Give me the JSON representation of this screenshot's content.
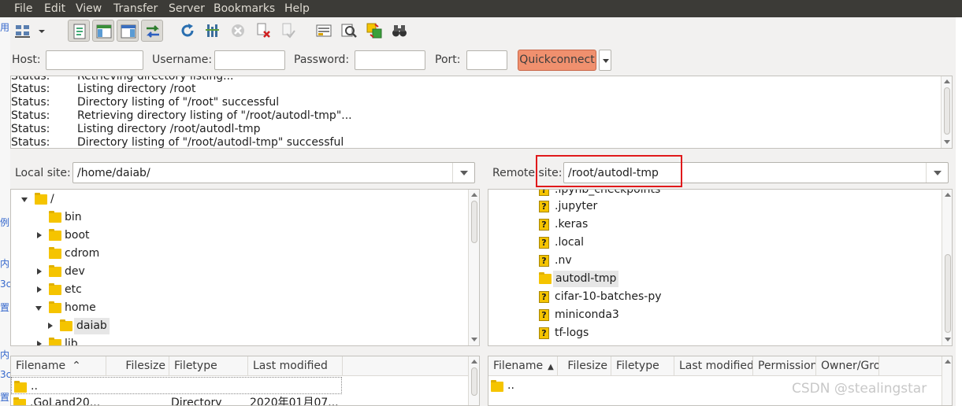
{
  "menubar": {
    "items": [
      "File",
      "Edit",
      "View",
      "Transfer",
      "Server",
      "Bookmarks",
      "Help"
    ]
  },
  "toolbar": {
    "icons": [
      "site-manager-icon",
      "site-manager-dropdown-icon",
      "toggle-message-log-icon",
      "toggle-local-tree-icon",
      "toggle-remote-tree-icon",
      "toggle-transfer-queue-icon",
      "refresh-icon",
      "process-queue-icon",
      "cancel-icon",
      "disconnect-icon",
      "reconnect-icon",
      "directory-filter-icon",
      "toggle-comparison-icon",
      "synchronized-browsing-icon",
      "search-remote-icon"
    ]
  },
  "quickconnect": {
    "host_label": "Host:",
    "host_value": "",
    "username_label": "Username:",
    "username_value": "",
    "password_label": "Password:",
    "password_value": "",
    "port_label": "Port:",
    "port_value": "",
    "button_label": "Quickconnect"
  },
  "message_log": [
    {
      "status": "Status:",
      "message": "Retrieving directory listing..."
    },
    {
      "status": "Status:",
      "message": "Listing directory /root"
    },
    {
      "status": "Status:",
      "message": "Directory listing of \"/root\" successful"
    },
    {
      "status": "Status:",
      "message": "Retrieving directory listing of \"/root/autodl-tmp\"..."
    },
    {
      "status": "Status:",
      "message": "Listing directory /root/autodl-tmp"
    },
    {
      "status": "Status:",
      "message": "Directory listing of \"/root/autodl-tmp\" successful"
    }
  ],
  "local_site": {
    "label": "Local site:",
    "path": "/home/daiab/",
    "tree": [
      {
        "name": "/",
        "expander": "down",
        "selected": false
      },
      {
        "name": "bin",
        "expander": "none",
        "selected": false
      },
      {
        "name": "boot",
        "expander": "right",
        "selected": false
      },
      {
        "name": "cdrom",
        "expander": "none",
        "selected": false
      },
      {
        "name": "dev",
        "expander": "right",
        "selected": false
      },
      {
        "name": "etc",
        "expander": "right",
        "selected": false
      },
      {
        "name": "home",
        "expander": "down",
        "selected": false
      },
      {
        "name": "daiab",
        "expander": "right",
        "selected": true
      },
      {
        "name": "lib",
        "expander": "right",
        "selected": false
      }
    ],
    "columns": [
      "Filename",
      "Filesize",
      "Filetype",
      "Last modified"
    ],
    "rows": [
      {
        "name": "..",
        "size": "",
        "type": "",
        "modified": ""
      },
      {
        "name": ".GoLand20...",
        "size": "",
        "type": "Directory",
        "modified": "2020年01月07..."
      }
    ]
  },
  "remote_site": {
    "label": "Remote site:",
    "path": "/root/autodl-tmp",
    "tree": [
      {
        "name": ".ipynb_checkpoints",
        "icon": "unknown",
        "selected": false
      },
      {
        "name": ".jupyter",
        "icon": "unknown",
        "selected": false
      },
      {
        "name": ".keras",
        "icon": "unknown",
        "selected": false
      },
      {
        "name": ".local",
        "icon": "unknown",
        "selected": false
      },
      {
        "name": ".nv",
        "icon": "unknown",
        "selected": false
      },
      {
        "name": "autodl-tmp",
        "icon": "folder",
        "selected": true
      },
      {
        "name": "cifar-10-batches-py",
        "icon": "unknown",
        "selected": false
      },
      {
        "name": "miniconda3",
        "icon": "unknown",
        "selected": false
      },
      {
        "name": "tf-logs",
        "icon": "unknown",
        "selected": false
      }
    ],
    "columns": [
      "Filename",
      "Filesize",
      "Filetype",
      "Last modified",
      "Permission",
      "Owner/Gro"
    ],
    "rows": [
      {
        "name": ".."
      }
    ]
  },
  "left_strip_fragments": [
    "用",
    "例",
    "内",
    "3c",
    "置",
    "内",
    "3c",
    "置"
  ],
  "watermark": "CSDN @stealingstar",
  "colors": {
    "menubar_bg": "#3c3b37",
    "quickconnect_accent": "#f0906e",
    "folder": "#f5c400",
    "highlight_box": "#e0191b"
  }
}
